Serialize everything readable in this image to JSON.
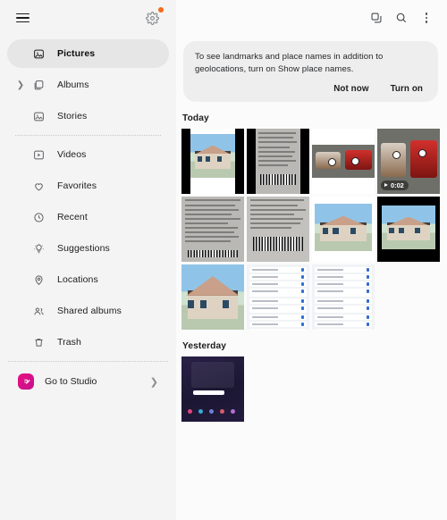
{
  "sidebar": {
    "menu_icon": "hamburger-icon",
    "settings_icon": "gear-icon",
    "items": [
      {
        "label": "Pictures",
        "icon": "picture-icon",
        "selected": true,
        "expandable": false
      },
      {
        "label": "Albums",
        "icon": "albums-icon",
        "selected": false,
        "expandable": true
      },
      {
        "label": "Stories",
        "icon": "stories-icon",
        "selected": false,
        "expandable": false
      },
      {
        "label": "Videos",
        "icon": "video-icon",
        "selected": false,
        "expandable": false
      },
      {
        "label": "Favorites",
        "icon": "heart-icon",
        "selected": false,
        "expandable": false
      },
      {
        "label": "Recent",
        "icon": "clock-icon",
        "selected": false,
        "expandable": false
      },
      {
        "label": "Suggestions",
        "icon": "lightbulb-icon",
        "selected": false,
        "expandable": false
      },
      {
        "label": "Locations",
        "icon": "location-pin-icon",
        "selected": false,
        "expandable": false
      },
      {
        "label": "Shared albums",
        "icon": "people-icon",
        "selected": false,
        "expandable": false
      },
      {
        "label": "Trash",
        "icon": "trash-icon",
        "selected": false,
        "expandable": false
      }
    ],
    "studio": {
      "label": "Go to Studio",
      "icon": "studio-icon",
      "chevron": "chevron-right-icon",
      "color": "#e8107f"
    }
  },
  "header": {
    "icons": [
      {
        "name": "duplicate-icon"
      },
      {
        "name": "search-icon"
      },
      {
        "name": "more-options-icon"
      }
    ]
  },
  "banner": {
    "message": "To see landmarks and place names in addition to geolocations, turn on Show place names.",
    "not_now_label": "Not now",
    "turn_on_label": "Turn on"
  },
  "sections": [
    {
      "title": "Today",
      "items": [
        {
          "kind": "editor",
          "bg": "black",
          "video": false
        },
        {
          "kind": "document",
          "bg": "black",
          "video": false
        },
        {
          "kind": "toys",
          "bg": "white",
          "video": false
        },
        {
          "kind": "toys",
          "bg": "white",
          "video": true,
          "duration": "0:02"
        },
        {
          "kind": "document",
          "bg": "plain",
          "video": false
        },
        {
          "kind": "document",
          "bg": "plain",
          "video": false
        },
        {
          "kind": "house",
          "bg": "white",
          "video": false
        },
        {
          "kind": "house",
          "bg": "black",
          "video": false
        },
        {
          "kind": "house",
          "bg": "plain",
          "video": false
        },
        {
          "kind": "settings",
          "bg": "plain",
          "video": false
        },
        {
          "kind": "settings",
          "bg": "plain",
          "video": false
        }
      ]
    },
    {
      "title": "Yesterday",
      "items": [
        {
          "kind": "phone",
          "bg": "plain",
          "video": false
        }
      ]
    }
  ],
  "colors": {
    "sidebar_bg": "#f4f4f4",
    "main_bg": "#fbfbfb",
    "banner_bg": "#eeeeee",
    "selected_bg": "#e6e6e6",
    "badge": "#f66a18",
    "studio": "#e8107f"
  }
}
